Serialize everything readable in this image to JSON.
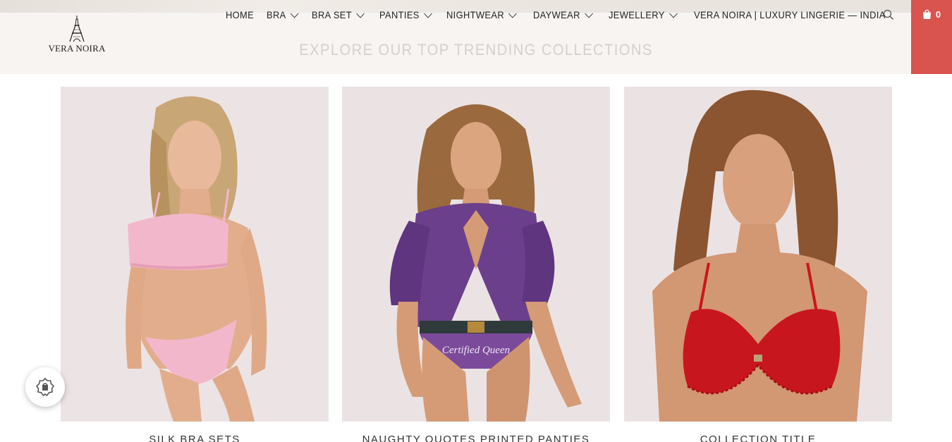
{
  "header": {
    "logo_text": "VERA NOIRA",
    "nav": [
      {
        "label": "HOME",
        "dropdown": false
      },
      {
        "label": "BRA",
        "dropdown": true
      },
      {
        "label": "BRA SET",
        "dropdown": true
      },
      {
        "label": "PANTIES",
        "dropdown": true
      },
      {
        "label": "NIGHTWEAR",
        "dropdown": true
      },
      {
        "label": "DAYWEAR",
        "dropdown": true
      },
      {
        "label": "JEWELLERY",
        "dropdown": true
      },
      {
        "label": "VERA NOIRA | LUXURY LINGERIE — INDIA",
        "dropdown": false
      }
    ],
    "search_icon": "search-icon",
    "cart_icon": "shopping-bag-icon",
    "cart_count": "0",
    "cart_color": "#d9534f"
  },
  "section": {
    "title": "EXPLORE OUR TOP TRENDING COLLECTIONS"
  },
  "collections": [
    {
      "title": "SILK BRA SETS",
      "image": "model-pink-satin-bra-set"
    },
    {
      "title": "NAUGHTY QUOTES PRINTED PANTIES",
      "image": "model-purple-shirt-printed-panty"
    },
    {
      "title": "COLLECTION TITLE",
      "image": "model-red-lace-bralette"
    }
  ],
  "panty_print": "Certified Queen",
  "floating_badge": {
    "icon": "reward-badge-icon"
  }
}
